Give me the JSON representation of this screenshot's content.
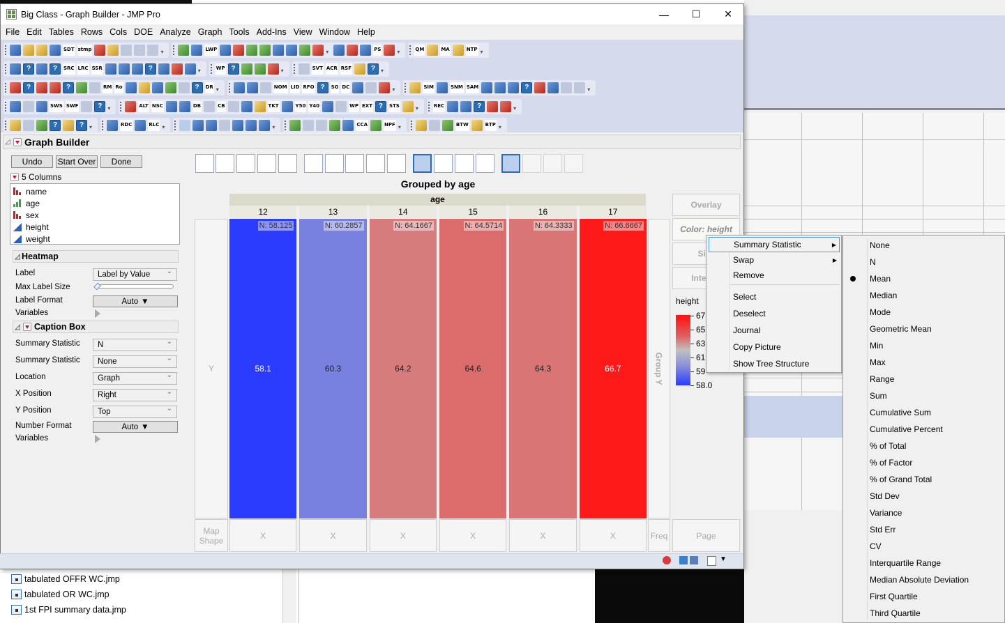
{
  "window": {
    "title": "Big Class - Graph Builder - JMP Pro",
    "controls": {
      "minimize": "—",
      "maximize": "☐",
      "close": "✕"
    }
  },
  "menubar": [
    "File",
    "Edit",
    "Tables",
    "Rows",
    "Cols",
    "DOE",
    "Analyze",
    "Graph",
    "Tools",
    "Add-Ins",
    "View",
    "Window",
    "Help"
  ],
  "toolbar_text_icons": [
    "SDT",
    "stmp",
    "LWP",
    "PS",
    "QM",
    "MA",
    "NTP",
    "SRC",
    "LRC",
    "SSR",
    "WP",
    "SVT",
    "ACR",
    "RSF",
    "RM",
    "Ro",
    "DR",
    "NOM",
    "LID",
    "RFO",
    "SG",
    "DC",
    "SIM",
    "SNM",
    "SAM",
    "SWS",
    "SWF",
    "ALT",
    "NSC",
    "DB",
    "CB",
    "TKT",
    "Y50",
    "Y40",
    "WP",
    "EXT",
    "STS",
    "REC",
    "RDC",
    "RLC",
    "CCA",
    "NPF",
    "BTW",
    "BTP"
  ],
  "graph_builder": {
    "title": "Graph Builder",
    "buttons": {
      "undo": "Undo",
      "start_over": "Start Over",
      "done": "Done"
    },
    "columns_header": "5 Columns",
    "columns": [
      {
        "name": "name",
        "type": "nominal"
      },
      {
        "name": "age",
        "type": "ordinal"
      },
      {
        "name": "sex",
        "type": "nominal"
      },
      {
        "name": "height",
        "type": "continuous"
      },
      {
        "name": "weight",
        "type": "continuous"
      }
    ],
    "heatmap": {
      "title": "Heatmap",
      "label_label": "Label",
      "label_value": "Label by Value",
      "max_label_size_label": "Max Label Size",
      "max_label_size_value": 0,
      "label_format_label": "Label Format",
      "label_format_value": "Auto",
      "variables_label": "Variables"
    },
    "caption_box": {
      "title": "Caption Box",
      "stat1_label": "Summary Statistic",
      "stat1_value": "N",
      "stat2_label": "Summary Statistic",
      "stat2_value": "None",
      "location_label": "Location",
      "location_value": "Graph",
      "xpos_label": "X Position",
      "xpos_value": "Right",
      "ypos_label": "Y Position",
      "ypos_value": "Top",
      "numfmt_label": "Number Format",
      "numfmt_value": "Auto",
      "variables_label": "Variables"
    },
    "graph_types": [
      "points",
      "smoother",
      "line-of-fit",
      "ellipse",
      "contour",
      "line",
      "bar",
      "area",
      "box-plot",
      "histogram",
      "heatmap",
      "pie",
      "treemap",
      "mosaic",
      "caption-box",
      "formula",
      "map-shapes",
      "parallel"
    ],
    "selected_graph_types": [
      "heatmap",
      "caption-box"
    ],
    "zones": {
      "y": "Y",
      "group_y": "Group Y",
      "map_shape": "Map Shape",
      "x": "X",
      "freq": "Freq",
      "page": "Page",
      "overlay": "Overlay",
      "color": "Color: height",
      "size": "Size",
      "interval": "Interval"
    },
    "legend": {
      "title": "height",
      "ticks": [
        "67",
        "65",
        "63",
        "61",
        "59",
        "58.0"
      ]
    }
  },
  "chart_data": {
    "type": "heatmap",
    "title": "Grouped by age",
    "xlabel": "age",
    "categories": [
      "12",
      "13",
      "14",
      "15",
      "16",
      "17"
    ],
    "values": [
      58.125,
      60.2857,
      64.1667,
      64.5714,
      64.3333,
      66.6667
    ],
    "value_labels": [
      "58.1",
      "60.3",
      "64.2",
      "64.6",
      "64.3",
      "66.7"
    ],
    "caption_labels": [
      "N: 58.125",
      "N: 60.2857",
      "N: 64.1667",
      "N: 64.5714",
      "N: 64.3333",
      "N: 66.6667"
    ],
    "colors": [
      "#2c3cff",
      "#7880e0",
      "#d77c7c",
      "#dc6b6b",
      "#d97575",
      "#ff1a1a"
    ],
    "color_range": [
      58.0,
      67.0
    ]
  },
  "context_menu": {
    "items": [
      {
        "label": "Summary Statistic",
        "submenu": true,
        "highlighted": true
      },
      {
        "label": "Swap",
        "submenu": true
      },
      {
        "label": "Remove"
      },
      {
        "label": "Select"
      },
      {
        "label": "Deselect"
      },
      {
        "label": "Journal"
      },
      {
        "label": "Copy Picture"
      },
      {
        "label": "Show Tree Structure"
      }
    ]
  },
  "submenu": {
    "selected": "Mean",
    "items": [
      "None",
      "N",
      "Mean",
      "Median",
      "Mode",
      "Geometric Mean",
      "Min",
      "Max",
      "Range",
      "Sum",
      "Cumulative Sum",
      "Cumulative Percent",
      "% of Total",
      "% of Factor",
      "% of Grand Total",
      "Std Dev",
      "Variance",
      "Std Err",
      "CV",
      "Interquartile Range",
      "Median Absolute Deviation",
      "First Quartile",
      "Third Quartile"
    ]
  },
  "background_files": [
    "tabulated OFFR WC.jmp",
    "tabulated OR WC.jmp",
    "1st FPI summary data.jmp"
  ]
}
